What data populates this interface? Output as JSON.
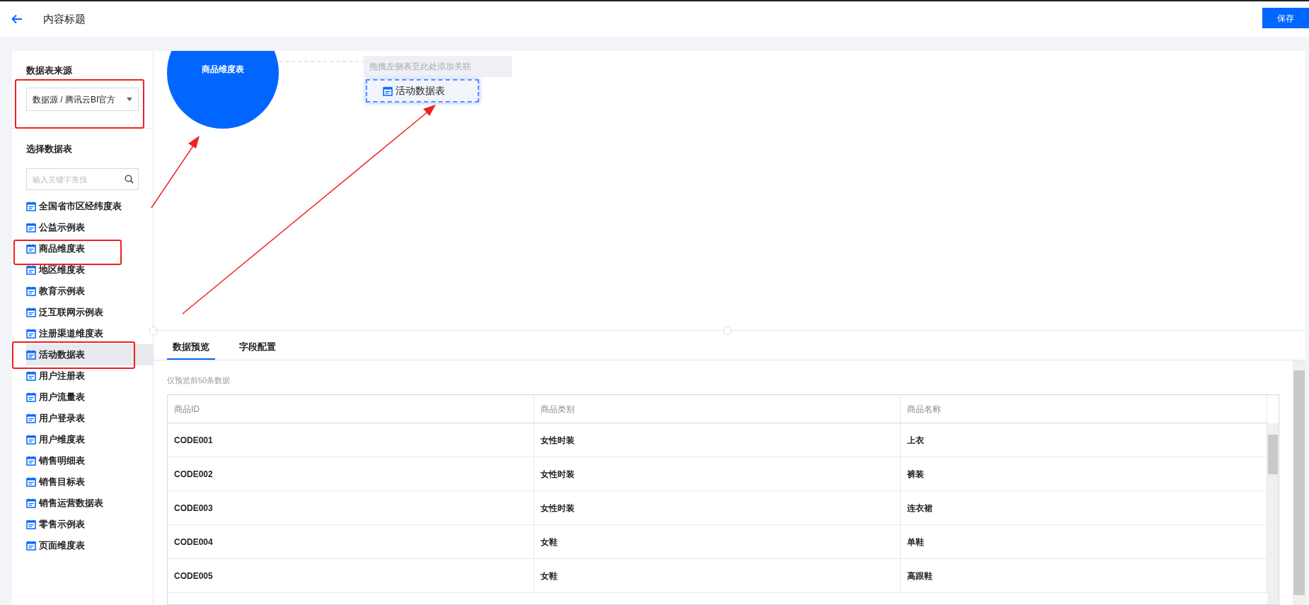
{
  "header": {
    "title": "内容标题",
    "save_button": "保存"
  },
  "sidebar": {
    "source_label": "数据表来源",
    "source_select": {
      "value": "数据源 / 腾讯云BI官方"
    },
    "tables_label": "选择数据表",
    "search": {
      "placeholder": "输入关键字查找"
    },
    "items": [
      {
        "label": "全国省市区经纬度表",
        "selected": false
      },
      {
        "label": "公益示例表",
        "selected": false
      },
      {
        "label": "商品维度表",
        "selected": false
      },
      {
        "label": "地区维度表",
        "selected": false
      },
      {
        "label": "教育示例表",
        "selected": false
      },
      {
        "label": "泛互联网示例表",
        "selected": false
      },
      {
        "label": "注册渠道维度表",
        "selected": false
      },
      {
        "label": "活动数据表",
        "selected": true
      },
      {
        "label": "用户注册表",
        "selected": false
      },
      {
        "label": "用户流量表",
        "selected": false
      },
      {
        "label": "用户登录表",
        "selected": false
      },
      {
        "label": "用户维度表",
        "selected": false
      },
      {
        "label": "销售明细表",
        "selected": false
      },
      {
        "label": "销售目标表",
        "selected": false
      },
      {
        "label": "销售运营数据表",
        "selected": false
      },
      {
        "label": "零售示例表",
        "selected": false
      },
      {
        "label": "页面维度表",
        "selected": false
      }
    ]
  },
  "canvas": {
    "node": {
      "label": "商品维度表"
    },
    "drop_hint": "拖拽左侧表至此处添加关联",
    "dragging": {
      "label": "活动数据表"
    }
  },
  "preview": {
    "tabs": [
      {
        "label": "数据预览",
        "selected": true
      },
      {
        "label": "字段配置",
        "selected": false
      }
    ],
    "note": "仅预览前50条数据",
    "table": {
      "columns": [
        "商品ID",
        "商品类别",
        "商品名称"
      ],
      "rows": [
        [
          "CODE001",
          "女性时装",
          "上衣"
        ],
        [
          "CODE002",
          "女性时装",
          "裤装"
        ],
        [
          "CODE003",
          "女性时装",
          "连衣裙"
        ],
        [
          "CODE004",
          "女鞋",
          "单鞋"
        ],
        [
          "CODE005",
          "女鞋",
          "高跟鞋"
        ]
      ]
    }
  }
}
